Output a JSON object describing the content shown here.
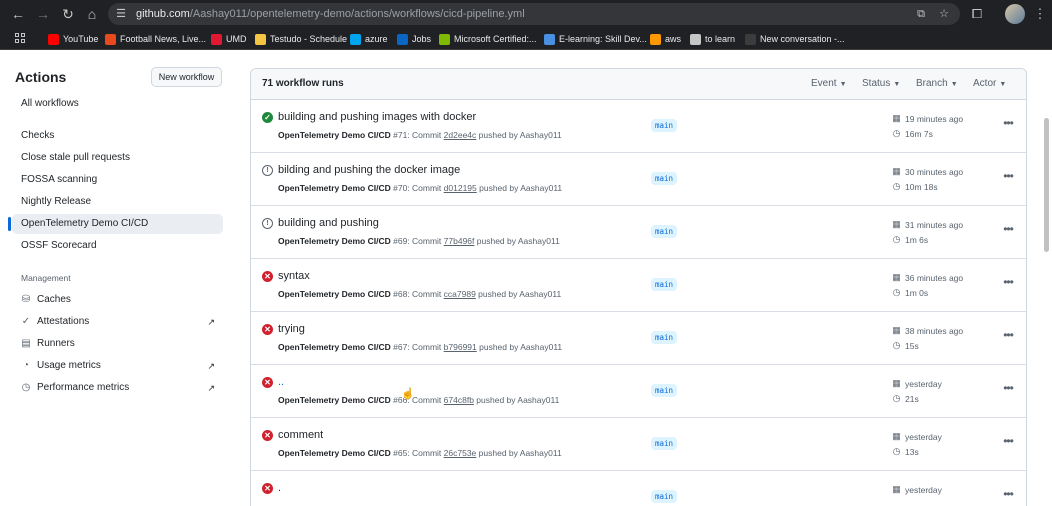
{
  "browser": {
    "url_host": "github.com",
    "url_path": "/Aashay011/opentelemetry-demo/actions/workflows/cicd-pipeline.yml",
    "bookmarks": [
      {
        "label": "YouTube",
        "icon": "youtube-icon",
        "color": "#ff0000"
      },
      {
        "label": "Football News, Live...",
        "icon": "football-news-icon",
        "color": "#e8491d"
      },
      {
        "label": "UMD",
        "icon": "umd-icon",
        "color": "#e21833"
      },
      {
        "label": "Testudo - Schedule",
        "icon": "testudo-icon",
        "color": "#f4c542"
      },
      {
        "label": "azure",
        "icon": "microsoft-icon",
        "color": "#00a4ef"
      },
      {
        "label": "Jobs",
        "icon": "linkedin-icon",
        "color": "#0a66c2"
      },
      {
        "label": "Microsoft Certified:...",
        "icon": "microsoft-icon",
        "color": "#7fba00"
      },
      {
        "label": "E-learning: Skill Dev...",
        "icon": "elearning-icon",
        "color": "#4a90e2"
      },
      {
        "label": "aws",
        "icon": "aws-icon",
        "color": "#ff9900"
      },
      {
        "label": "to learn",
        "icon": "folder-icon",
        "color": "#c4c7c5"
      },
      {
        "label": "New conversation -...",
        "icon": "chat-icon",
        "color": "#3c3c3c"
      }
    ]
  },
  "sidebar": {
    "title": "Actions",
    "new_workflow": "New workflow",
    "items": [
      {
        "label": "All workflows"
      },
      {
        "label": "Checks"
      },
      {
        "label": "Close stale pull requests"
      },
      {
        "label": "FOSSA scanning"
      },
      {
        "label": "Nightly Release"
      },
      {
        "label": "OpenTelemetry Demo CI/CD"
      },
      {
        "label": "OSSF Scorecard"
      }
    ],
    "management_title": "Management",
    "management": [
      {
        "label": "Caches",
        "icon": "database-icon",
        "glyph": "⛁",
        "external": ""
      },
      {
        "label": "Attestations",
        "icon": "verified-icon",
        "glyph": "✓",
        "external": "↗"
      },
      {
        "label": "Runners",
        "icon": "server-icon",
        "glyph": "▤",
        "external": ""
      },
      {
        "label": "Usage metrics",
        "icon": "graph-icon",
        "glyph": "◔",
        "external": "↗"
      },
      {
        "label": "Performance metrics",
        "icon": "stopwatch-icon",
        "glyph": "◷",
        "external": "↗"
      }
    ]
  },
  "runs": {
    "count_label": "71 workflow runs",
    "filters": [
      "Event",
      "Status",
      "Branch",
      "Actor"
    ],
    "items": [
      {
        "status": "success",
        "title": "building and pushing images with docker",
        "workflow": "OpenTelemetry Demo CI/CD",
        "number": "#71",
        "commit": "2d2ee4c",
        "actor": "Aashay011",
        "branch": "main",
        "ago": "19 minutes ago",
        "duration": "16m 7s"
      },
      {
        "status": "neutral",
        "title": "bilding and pushing the docker image",
        "workflow": "OpenTelemetry Demo CI/CD",
        "number": "#70",
        "commit": "d012195",
        "actor": "Aashay011",
        "branch": "main",
        "ago": "30 minutes ago",
        "duration": "10m 18s"
      },
      {
        "status": "neutral",
        "title": "building and pushing",
        "workflow": "OpenTelemetry Demo CI/CD",
        "number": "#69",
        "commit": "77b496f",
        "actor": "Aashay011",
        "branch": "main",
        "ago": "31 minutes ago",
        "duration": "1m 6s"
      },
      {
        "status": "failure",
        "title": "syntax",
        "workflow": "OpenTelemetry Demo CI/CD",
        "number": "#68",
        "commit": "cca7989",
        "actor": "Aashay011",
        "branch": "main",
        "ago": "36 minutes ago",
        "duration": "1m 0s"
      },
      {
        "status": "failure",
        "title": "trying",
        "workflow": "OpenTelemetry Demo CI/CD",
        "number": "#67",
        "commit": "b796991",
        "actor": "Aashay011",
        "branch": "main",
        "ago": "38 minutes ago",
        "duration": "15s"
      },
      {
        "status": "failure",
        "title": "..",
        "workflow": "OpenTelemetry Demo CI/CD",
        "number": "#66",
        "commit": "674c8fb",
        "actor": "Aashay011",
        "branch": "main",
        "ago": "yesterday",
        "duration": "21s"
      },
      {
        "status": "failure",
        "title": "comment",
        "workflow": "OpenTelemetry Demo CI/CD",
        "number": "#65",
        "commit": "26c753e",
        "actor": "Aashay011",
        "branch": "main",
        "ago": "yesterday",
        "duration": "13s"
      },
      {
        "status": "failure",
        "title": ".",
        "workflow": "",
        "number": "",
        "commit": "",
        "actor": "",
        "branch": "main",
        "ago": "yesterday",
        "duration": ""
      }
    ]
  },
  "colors": {
    "success": "#1f883d",
    "failure": "#cf222e",
    "accent": "#0969da"
  }
}
